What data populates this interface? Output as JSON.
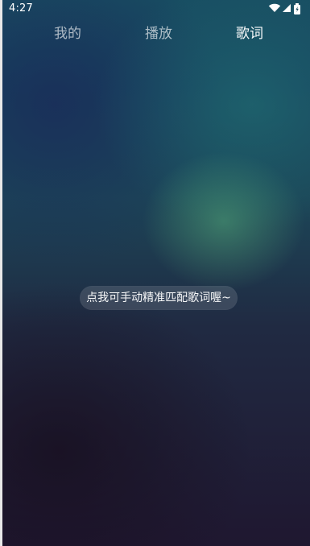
{
  "status_bar": {
    "time": "4:27",
    "icons": [
      "wifi-icon",
      "signal-icon",
      "battery-icon"
    ]
  },
  "tabs": [
    {
      "label": "我的",
      "active": false
    },
    {
      "label": "播放",
      "active": false
    },
    {
      "label": "歌词",
      "active": true
    }
  ],
  "lyrics_tip": {
    "text": "点我可手动精准匹配歌词喔~"
  },
  "colors": {
    "active_tab": "#ffffff",
    "inactive_tab": "#9db3bf",
    "background_top": "#184d62",
    "background_bottom": "#1f1730",
    "tip_background": "#405c66"
  }
}
